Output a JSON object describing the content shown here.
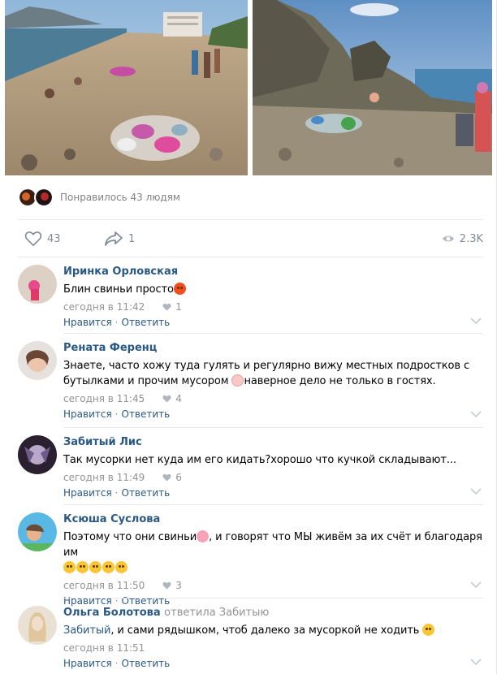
{
  "post": {
    "photos": [
      {
        "icon": "beach-trash-photo-1"
      },
      {
        "icon": "beach-trash-photo-2"
      }
    ],
    "likes_summary": "Понравилось 43 людям",
    "like_count": "43",
    "share_count": "1",
    "views": "2.3K"
  },
  "comments": [
    {
      "author": "Иринка Орловская",
      "text": "Блин свиньи просто",
      "emoji": "angry-face-emoji",
      "time": "сегодня в 11:42",
      "likes": "1",
      "like_label": "Нравится",
      "reply_label": "Ответить"
    },
    {
      "author": "Рената Ференц",
      "text_line1": "Знаете, часто хожу туда гулять и регулярно вижу местных подростков с",
      "text_line2a": "бутылками и прочим мусором",
      "text_line2b": "наверное дело не только в гостях.",
      "emoji": "person-gesturing-emoji",
      "time": "сегодня в 11:45",
      "likes": "4",
      "like_label": "Нравится",
      "reply_label": "Ответить"
    },
    {
      "author": "Забитый Лис",
      "text": "Так мусорки нет куда им его кидать?хорошо что кучкой складывают...",
      "time": "сегодня в 11:49",
      "likes": "6",
      "like_label": "Нравится",
      "reply_label": "Ответить"
    },
    {
      "author": "Ксюша Суслова",
      "text_a": "Поэтому что они свиньи",
      "text_b": ", и говорят что МЫ живём за их счёт и благодаря им",
      "emoji": "pig-face-emoji",
      "emoji_row": "rolling-laughing-emoji-x5",
      "time": "сегодня в 11:50",
      "likes": "3",
      "like_label": "Нравится",
      "reply_label": "Ответить"
    },
    {
      "author": "Ольга Болотова",
      "reply_note": "ответила Забитыю",
      "mention": "Забитый",
      "text": ", и сами рядышком, чтоб далеко за мусоркой не ходить",
      "emoji": "eye-roll-emoji",
      "time": "сегодня в 11:51",
      "like_label": "Нравится",
      "reply_label": "Ответить"
    }
  ],
  "colors": {
    "link": "#2a5885",
    "muted": "#939393",
    "divider": "#e7e8ec"
  }
}
